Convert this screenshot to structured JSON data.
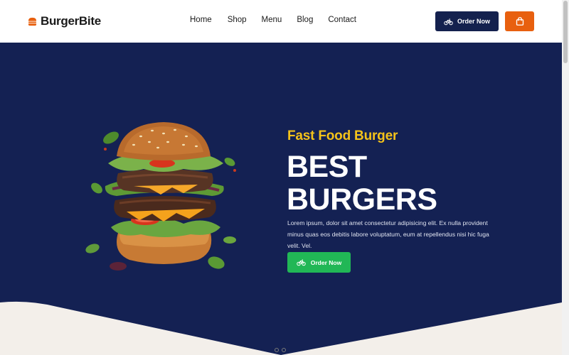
{
  "brand": {
    "name": "BurgerBite"
  },
  "nav": {
    "items": [
      "Home",
      "Shop",
      "Menu",
      "Blog",
      "Contact"
    ]
  },
  "header": {
    "order_label": "Order Now",
    "cart_icon": "shopping-bag-icon"
  },
  "hero": {
    "subtitle": "Fast Food Burger",
    "title_line1": "BEST",
    "title_line2": "BURGERS",
    "description": "Lorem ipsum, dolor sit amet consectetur adipisicing elit. Ex nulla provident minus quas eos debitis labore voluptatum, eum at repellendus nisi hic fuga velit. Vel.",
    "order_label": "Order Now"
  },
  "colors": {
    "navy": "#142153",
    "accent_yellow": "#f4c21a",
    "orange": "#e8600f",
    "green": "#21b756"
  },
  "slider": {
    "dots": 2
  }
}
